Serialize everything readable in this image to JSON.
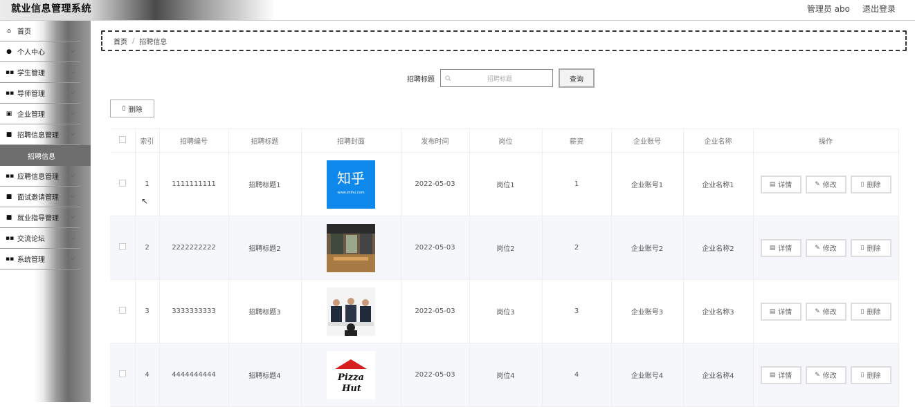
{
  "app": {
    "title": "就业信息管理系统",
    "admin_label": "管理员 abo",
    "logout_label": "退出登录"
  },
  "sidebar": {
    "items": [
      {
        "label": "首页",
        "icon": "home-icon",
        "glyph": "⌂",
        "expandable": false
      },
      {
        "label": "个人中心",
        "icon": "user-icon",
        "glyph": "●",
        "expandable": true
      },
      {
        "label": "学生管理",
        "icon": "grid-icon",
        "glyph": "▪▪",
        "expandable": true
      },
      {
        "label": "导师管理",
        "icon": "grid-icon",
        "glyph": "▪▪",
        "expandable": true
      },
      {
        "label": "企业管理",
        "icon": "doc-icon",
        "glyph": "▣",
        "expandable": true
      },
      {
        "label": "招聘信息管理",
        "icon": "chat-icon",
        "glyph": "■",
        "expandable": true
      }
    ],
    "active_sub": "招聘信息",
    "items2": [
      {
        "label": "应聘信息管理",
        "icon": "grid-icon",
        "glyph": "▪▪",
        "expandable": true
      },
      {
        "label": "面试邀请管理",
        "icon": "chat-icon",
        "glyph": "■",
        "expandable": true
      },
      {
        "label": "就业指导管理",
        "icon": "chat-icon",
        "glyph": "■",
        "expandable": true
      },
      {
        "label": "交流论坛",
        "icon": "grid-icon",
        "glyph": "▪▪",
        "expandable": true
      },
      {
        "label": "系统管理",
        "icon": "grid-icon",
        "glyph": "▪▪",
        "expandable": true
      }
    ]
  },
  "breadcrumb": {
    "home": "首页",
    "current": "招聘信息"
  },
  "search": {
    "label": "招聘标题",
    "placeholder": "招聘标题",
    "button": "查询"
  },
  "toolbar": {
    "delete_label": "删除"
  },
  "table": {
    "headers": [
      "索引",
      "招聘编号",
      "招聘标题",
      "招聘封面",
      "发布时间",
      "岗位",
      "薪资",
      "企业账号",
      "企业名称",
      "操作"
    ],
    "rows": [
      {
        "index": "1",
        "code": "1111111111",
        "title": "招聘标题1",
        "cover": "zhihu-logo",
        "date": "2022-05-03",
        "position": "岗位1",
        "salary": "1",
        "account": "企业账号1",
        "company": "企业名称1"
      },
      {
        "index": "2",
        "code": "2222222222",
        "title": "招聘标题2",
        "cover": "office-photo",
        "date": "2022-05-03",
        "position": "岗位2",
        "salary": "2",
        "account": "企业账号2",
        "company": "企业名称2"
      },
      {
        "index": "3",
        "code": "3333333333",
        "title": "招聘标题3",
        "cover": "interview-photo",
        "date": "2022-05-03",
        "position": "岗位3",
        "salary": "3",
        "account": "企业账号3",
        "company": "企业名称3"
      },
      {
        "index": "4",
        "code": "4444444444",
        "title": "招聘标题4",
        "cover": "pizzahut-logo",
        "date": "2022-05-03",
        "position": "岗位4",
        "salary": "4",
        "account": "企业账号4",
        "company": "企业名称4"
      }
    ],
    "actions": {
      "detail": "详情",
      "edit": "修改",
      "delete": "删除"
    }
  },
  "covers": {
    "zhihu_text": "知乎",
    "zhihu_url": "www.zhihu.com",
    "pizza_text": "Pizza Hut"
  },
  "colors": {
    "zhihu_blue": "#0f88eb",
    "pizza_red": "#d81e1e"
  }
}
